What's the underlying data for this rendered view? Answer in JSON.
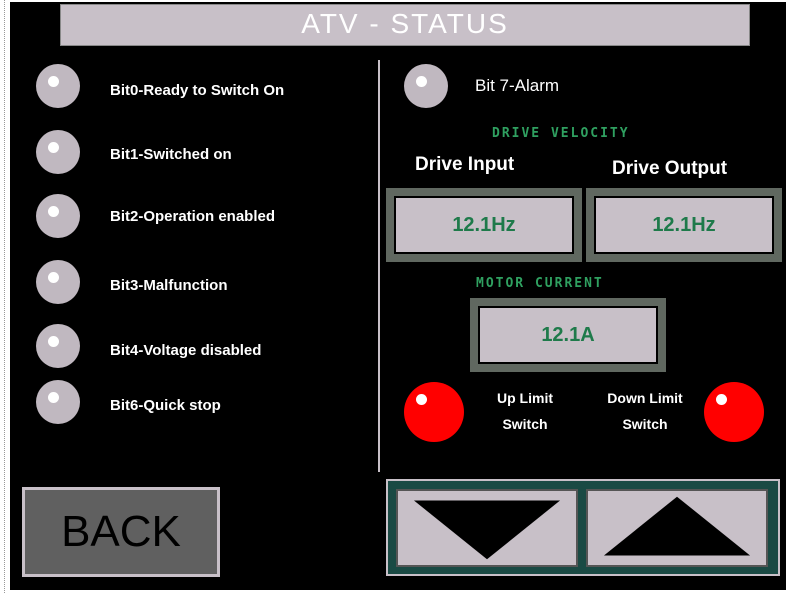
{
  "title": "ATV  -  STATUS",
  "status_bits": [
    {
      "label": "Bit0-Ready to Switch On"
    },
    {
      "label": "Bit1-Switched on"
    },
    {
      "label": "Bit2-Operation enabled"
    },
    {
      "label": "Bit3-Malfunction"
    },
    {
      "label": "Bit4-Voltage disabled"
    },
    {
      "label": "Bit6-Quick stop"
    }
  ],
  "alarm": {
    "label": "Bit 7-Alarm"
  },
  "drive_velocity": {
    "title": "DRIVE VELOCITY",
    "input_label": "Drive Input",
    "output_label": "Drive Output",
    "input_value": "12.1Hz",
    "output_value": "12.1Hz"
  },
  "motor_current": {
    "title": "MOTOR CURRENT",
    "value": "12.1A"
  },
  "limits": {
    "up_line1": "Up Limit",
    "up_line2": "Switch",
    "down_line1": "Down Limit",
    "down_line2": "Switch"
  },
  "colors": {
    "indicator_off": "#c0b8c0",
    "indicator_on": "#ff0000",
    "value_text": "#1e7a4a",
    "section_title": "#2fa060"
  },
  "buttons": {
    "back": "BACK",
    "down_icon": "triangle-down-icon",
    "up_icon": "triangle-up-icon"
  }
}
